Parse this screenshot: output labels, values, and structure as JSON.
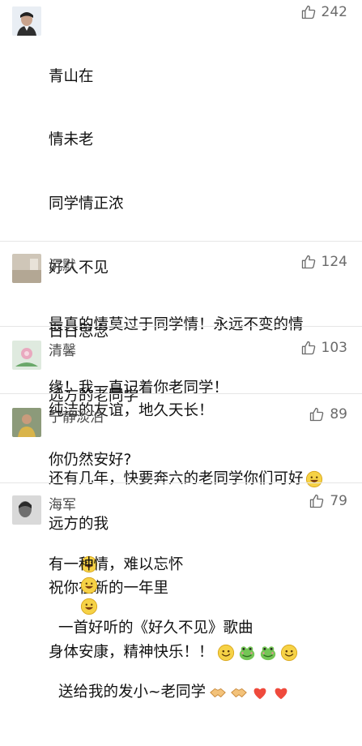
{
  "colors": {
    "text": "#111111",
    "name": "#4a4a4a",
    "like": "#6b6b6b",
    "separator": "#e6e6e6",
    "emoji_yellow": "#f6d246",
    "emoji_green": "#74c655"
  },
  "comments": [
    {
      "name": "",
      "likes": "242",
      "lines": [
        "青山在",
        "情未老",
        "同学情正浓",
        "好久不见",
        "日日思念",
        "远方的老同学",
        "你仍然安好?",
        "远方的我",
        "祝你在新的一年里",
        "身体安康，精神快乐！！"
      ]
    },
    {
      "name": "沉默",
      "likes": "124",
      "lines": [
        "最真的情莫过于同学情！永远不变的情",
        "缘！我一直记着你老同学！"
      ]
    },
    {
      "name": "清馨",
      "likes": "103",
      "lines": [
        "纯洁的友谊，地久天长！"
      ]
    },
    {
      "name": "宁静淡泊",
      "likes": "89",
      "lines": [
        "还有几年，快要奔六的老同学你们可好"
      ]
    },
    {
      "name": "海军",
      "likes": "79",
      "lines": [
        "有一种情，难以忘怀",
        "一首好听的《好久不见》歌曲",
        "送给我的发小~老同学"
      ]
    }
  ]
}
